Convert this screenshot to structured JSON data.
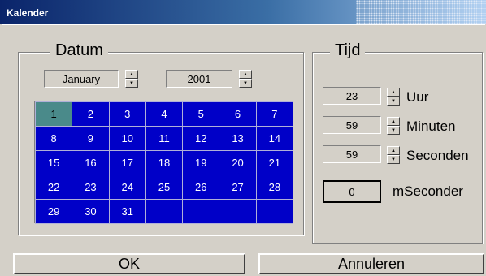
{
  "window": {
    "title": "Kalender"
  },
  "datum": {
    "legend": "Datum",
    "month": "January",
    "year": "2001",
    "days": [
      [
        "1",
        "2",
        "3",
        "4",
        "5",
        "6",
        "7"
      ],
      [
        "8",
        "9",
        "10",
        "11",
        "12",
        "13",
        "14"
      ],
      [
        "15",
        "16",
        "17",
        "18",
        "19",
        "20",
        "21"
      ],
      [
        "22",
        "23",
        "24",
        "25",
        "26",
        "27",
        "28"
      ],
      [
        "29",
        "30",
        "31",
        "",
        "",
        "",
        ""
      ]
    ],
    "selected_day": "1"
  },
  "tijd": {
    "legend": "Tijd",
    "uur_value": "23",
    "uur_label": "Uur",
    "minuten_value": "59",
    "minuten_label": "Minuten",
    "seconden_value": "59",
    "seconden_label": "Seconden",
    "mseconden_value": "0",
    "mseconden_label": "mSeconder"
  },
  "buttons": {
    "ok": "OK",
    "cancel": "Annuleren"
  },
  "colors": {
    "calendar_bg": "#0000c8",
    "selected_cell": "#4a8a8a",
    "titlebar_start": "#0a246a"
  }
}
